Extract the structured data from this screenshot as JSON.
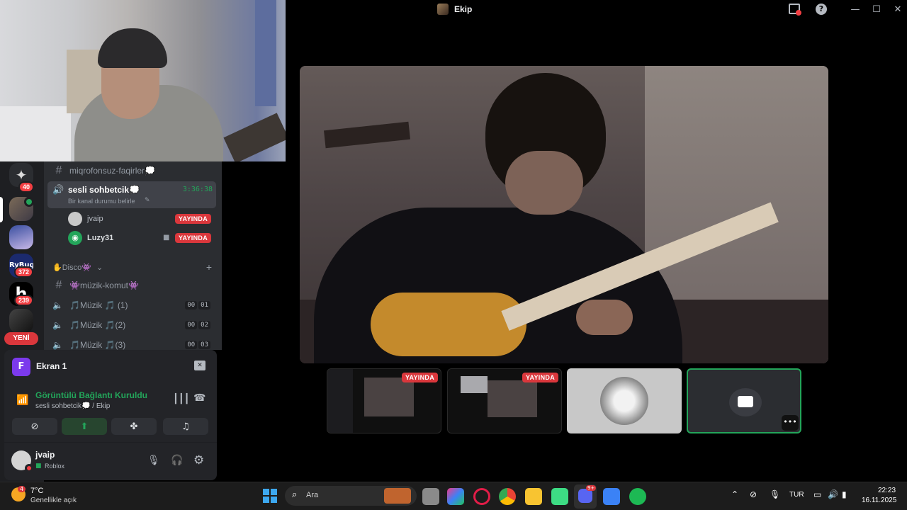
{
  "window": {
    "title": "Ekip"
  },
  "channels": {
    "top_channel": "miqrofonsuz-faqirler",
    "top_channel_emoji": "💭",
    "voice_active": {
      "name": "sesli sohbetcik",
      "emoji": "💭",
      "timer": "3:36:38",
      "status": "Bir kanal durumu belirle"
    },
    "participants": [
      {
        "name": "jvaip",
        "badge": "YAYINDA"
      },
      {
        "name": "Luzy31",
        "badge": "YAYINDA"
      }
    ],
    "category": {
      "name": "Disco",
      "prefix": "✋",
      "suffix": "👾"
    },
    "text_channel": {
      "name": "müzik-komut",
      "prefix": "👾",
      "suffix": "👾"
    },
    "music_channels": [
      {
        "name": "🎵Müzik 🎵 (1)",
        "c1": "00",
        "c2": "01"
      },
      {
        "name": "🎵Müzik 🎵(2)",
        "c1": "00",
        "c2": "02"
      },
      {
        "name": "🎵Müzik 🎵(3)",
        "c1": "00",
        "c2": "03"
      }
    ]
  },
  "servers": {
    "badges": [
      "40",
      "372",
      "239"
    ],
    "new_label": "YENİ"
  },
  "screen_share": {
    "name": "Ekran 1",
    "initial": "F"
  },
  "voice_status": {
    "title": "Görüntülü Bağlantı Kuruldu",
    "subtitle": "sesli sohbetcik💭 / Ekip"
  },
  "user": {
    "name": "jvaip",
    "activity": "Roblox"
  },
  "streams": {
    "live_label_1": "YAYINDA",
    "live_label_2": "YAYINDA"
  },
  "taskbar": {
    "weather_temp": "7°C",
    "weather_desc": "Genellikle açık",
    "weather_badge": "4",
    "search_placeholder": "Ara",
    "discord_badge": "9+",
    "lang": "TUR",
    "time": "22:23",
    "date": "16.11.2025"
  },
  "colors": {
    "accent": "#5865f2",
    "green": "#23a55a",
    "red": "#da373c",
    "bg": "#000000"
  }
}
